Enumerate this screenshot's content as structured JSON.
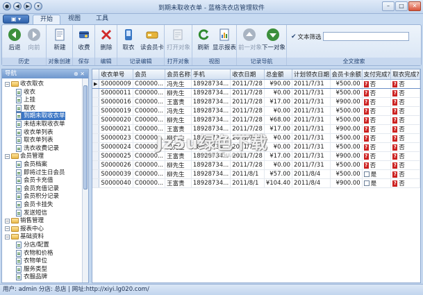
{
  "window": {
    "title": "到期未取收衣单 - 蓝格洗衣店管理软件"
  },
  "tabs": [
    "开始",
    "视图",
    "工具"
  ],
  "ribbon": {
    "groups": [
      {
        "caption": "历史",
        "buttons": [
          {
            "label": "后退",
            "icon": "back-arrow-icon"
          },
          {
            "label": "向前",
            "icon": "forward-arrow-icon"
          }
        ]
      },
      {
        "caption": "对象创建",
        "buttons": [
          {
            "label": "新建",
            "icon": "new-document-icon"
          }
        ]
      },
      {
        "caption": "保存",
        "buttons": [
          {
            "label": "收费",
            "icon": "charge-icon"
          }
        ]
      },
      {
        "caption": "编辑",
        "buttons": [
          {
            "label": "删除",
            "icon": "delete-x-icon"
          }
        ]
      },
      {
        "caption": "记录编辑",
        "buttons": [
          {
            "label": "取衣",
            "icon": "pickup-icon"
          },
          {
            "label": "读会员卡",
            "icon": "member-card-icon"
          }
        ]
      },
      {
        "caption": "打开对象",
        "buttons": [
          {
            "label": "打开对象",
            "icon": "open-object-icon"
          }
        ]
      },
      {
        "caption": "视图",
        "buttons": [
          {
            "label": "刷新",
            "icon": "refresh-icon"
          },
          {
            "label": "显示报表",
            "icon": "report-icon"
          }
        ]
      },
      {
        "caption": "记录导航",
        "buttons": [
          {
            "label": "前一对象",
            "icon": "up-arrow-icon"
          },
          {
            "label": "下一对象",
            "icon": "down-arrow-icon"
          }
        ]
      },
      {
        "caption": "全文搜索",
        "search_label": "文本筛选",
        "search_value": ""
      }
    ]
  },
  "nav": {
    "header": "导航",
    "items": [
      {
        "label": "收衣取衣",
        "level": 0,
        "kind": "folder"
      },
      {
        "label": "收衣",
        "level": 1,
        "kind": "doc"
      },
      {
        "label": "上挂",
        "level": 1,
        "kind": "doc"
      },
      {
        "label": "取衣",
        "level": 1,
        "kind": "doc"
      },
      {
        "label": "到期未取收衣单",
        "level": 1,
        "kind": "doc"
      },
      {
        "label": "未结未取收衣单",
        "level": 1,
        "kind": "doc"
      },
      {
        "label": "收衣单列表",
        "level": 1,
        "kind": "doc"
      },
      {
        "label": "取衣单列表",
        "level": 1,
        "kind": "doc"
      },
      {
        "label": "洗衣收费记录",
        "level": 1,
        "kind": "doc"
      },
      {
        "label": "会员管理",
        "level": 0,
        "kind": "folder"
      },
      {
        "label": "会员档案",
        "level": 1,
        "kind": "doc"
      },
      {
        "label": "即将过生日会员",
        "level": 1,
        "kind": "doc"
      },
      {
        "label": "会员卡充值",
        "level": 1,
        "kind": "doc"
      },
      {
        "label": "会员充值记录",
        "level": 1,
        "kind": "doc"
      },
      {
        "label": "会员积分记录",
        "level": 1,
        "kind": "doc"
      },
      {
        "label": "会员卡挂失",
        "level": 1,
        "kind": "doc"
      },
      {
        "label": "发送短信",
        "level": 1,
        "kind": "doc"
      },
      {
        "label": "销售管理",
        "level": 0,
        "kind": "folder"
      },
      {
        "label": "报表中心",
        "level": 0,
        "kind": "folder"
      },
      {
        "label": "基础资料",
        "level": 0,
        "kind": "folder"
      },
      {
        "label": "分店/配置",
        "level": 1,
        "kind": "doc"
      },
      {
        "label": "衣物和价格",
        "level": 1,
        "kind": "doc"
      },
      {
        "label": "衣物单位",
        "level": 1,
        "kind": "doc"
      },
      {
        "label": "服务类型",
        "level": 1,
        "kind": "doc"
      },
      {
        "label": "衣服品牌",
        "level": 1,
        "kind": "doc"
      }
    ]
  },
  "grid": {
    "columns": [
      "收衣单号",
      "会员",
      "会员名称",
      "手机",
      "收衣日期",
      "总金额",
      "计划领衣日期",
      "会员卡余额",
      "支付完成?",
      "取衣完成?"
    ],
    "rows": [
      {
        "no": "S0000009",
        "member": "C00000...",
        "name": "冯先生",
        "phone": "18928734...",
        "date": "2011/7/28",
        "amount": "¥90.00",
        "plan": "2011/7/31",
        "balance": "¥500.00",
        "paid": "否",
        "picked": "否"
      },
      {
        "no": "S0000011",
        "member": "C00000...",
        "name": "柳先生",
        "phone": "18928734...",
        "date": "2011/7/28",
        "amount": "¥0.00",
        "plan": "2011/7/31",
        "balance": "¥500.00",
        "paid": "否",
        "picked": "否"
      },
      {
        "no": "S0000016",
        "member": "C00000...",
        "name": "王富贵",
        "phone": "18928734...",
        "date": "2011/7/28",
        "amount": "¥17.00",
        "plan": "2011/7/31",
        "balance": "¥900.00",
        "paid": "否",
        "picked": "否"
      },
      {
        "no": "S0000019",
        "member": "C00000...",
        "name": "冯先生",
        "phone": "18928734...",
        "date": "2011/7/28",
        "amount": "¥0.00",
        "plan": "2011/7/31",
        "balance": "¥500.00",
        "paid": "否",
        "picked": "否"
      },
      {
        "no": "S0000020",
        "member": "C00000...",
        "name": "柳先生",
        "phone": "18928734...",
        "date": "2011/7/28",
        "amount": "¥68.00",
        "plan": "2011/7/31",
        "balance": "¥500.00",
        "paid": "否",
        "picked": "否"
      },
      {
        "no": "S0000021",
        "member": "C00000...",
        "name": "王富贵",
        "phone": "18928734...",
        "date": "2011/7/28",
        "amount": "¥17.00",
        "plan": "2011/7/31",
        "balance": "¥900.00",
        "paid": "否",
        "picked": "否"
      },
      {
        "no": "S0000023",
        "member": "C00000...",
        "name": "柳先生",
        "phone": "18928734...",
        "date": "2011/7/28",
        "amount": "¥0.00",
        "plan": "2011/7/31",
        "balance": "¥500.00",
        "paid": "否",
        "picked": "否"
      },
      {
        "no": "S0000024",
        "member": "C00000...",
        "name": "冯先生",
        "phone": "18928734...",
        "date": "2011/7/28",
        "amount": "¥0.00",
        "plan": "2011/7/31",
        "balance": "¥500.00",
        "paid": "否",
        "picked": "否"
      },
      {
        "no": "S0000025",
        "member": "C00000...",
        "name": "王富贵",
        "phone": "18928734...",
        "date": "2011/7/28",
        "amount": "¥17.00",
        "plan": "2011/7/31",
        "balance": "¥900.00",
        "paid": "否",
        "picked": "否"
      },
      {
        "no": "S0000026",
        "member": "C00000...",
        "name": "柳先生",
        "phone": "18928734...",
        "date": "2011/7/28",
        "amount": "¥0.00",
        "plan": "2011/7/31",
        "balance": "¥500.00",
        "paid": "否",
        "picked": "否"
      },
      {
        "no": "S0000039",
        "member": "C00000...",
        "name": "柳先生",
        "phone": "18928734...",
        "date": "2011/8/1",
        "amount": "¥57.00",
        "plan": "2011/8/4",
        "balance": "¥500.00",
        "paid": "是",
        "picked": "否"
      },
      {
        "no": "S0000040",
        "member": "C00000...",
        "name": "王富贵",
        "phone": "18928734...",
        "date": "2011/8/1",
        "amount": "¥104.40",
        "plan": "2011/8/4",
        "balance": "¥900.00",
        "paid": "是",
        "picked": "否"
      }
    ]
  },
  "watermark": {
    "main": "Jz5u绿色下载",
    "sub": "www.jz5u.com"
  },
  "status": {
    "text": "用户: admin  分店: 总店  |  网址:http://xiyi.lg020.com/"
  },
  "colors": {
    "selection": "#3a75c4",
    "accent": "#2d5fa8",
    "flag_red": "#cc2222"
  }
}
